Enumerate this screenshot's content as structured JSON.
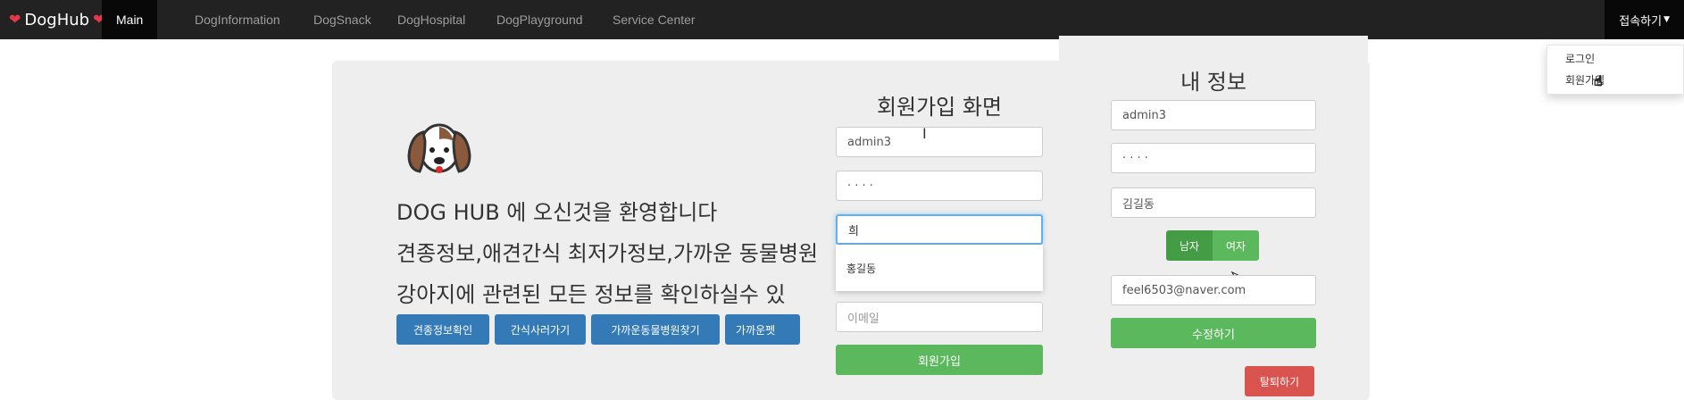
{
  "nav": {
    "brand": "DogHub",
    "items": [
      {
        "label": "Main",
        "active": true
      },
      {
        "label": "DogInformation"
      },
      {
        "label": "DogSnack"
      },
      {
        "label": "DogHospital"
      },
      {
        "label": "DogPlayground"
      },
      {
        "label": "Service Center"
      }
    ],
    "account_label": "접속하기",
    "dropdown": [
      "로그인",
      "회원가입"
    ]
  },
  "main": {
    "welcome": "DOG HUB 에 오신것을 환영합니다",
    "line2": "견종정보,애견간식 최저가정보,가까운 동물병원",
    "line3": "강아지에 관련된 모든 정보를 확인하실수 있",
    "buttons": [
      "견종정보확인",
      "간식사러가기",
      "가까운동물병원찾기",
      "가까운펫"
    ]
  },
  "signup": {
    "title": "회원가입 화면",
    "id_value": "admin3",
    "password_value": "· · · ·",
    "name_value": "희",
    "autocomplete": "홍길동",
    "email_placeholder": "이메일",
    "submit": "회원가입"
  },
  "myinfo": {
    "title": "내 정보",
    "id_value": "admin3",
    "password_value": "· · · ·",
    "name_value": "김길동",
    "gender": [
      "남자",
      "여자"
    ],
    "email_value": "feel6503@naver.com",
    "update_button": "수정하기",
    "withdraw_button": "탈퇴하기"
  },
  "colors": {
    "navbar": "#222222",
    "primary": "#337ab7",
    "success": "#5cb85c",
    "danger": "#d9534f",
    "heart": "#e8364a"
  }
}
